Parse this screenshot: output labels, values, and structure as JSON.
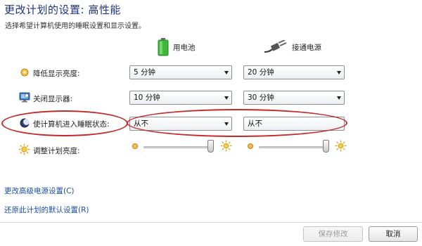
{
  "page": {
    "title": "更改计划的设置: 高性能",
    "subtitle": "选择希望计算机使用的睡眠设置和显示设置。"
  },
  "columns": {
    "battery": {
      "label": "用电池",
      "icon": "battery-icon"
    },
    "plugged": {
      "label": "接通电源",
      "icon": "power-plug-icon"
    }
  },
  "settings": {
    "dim_display": {
      "label": "降低显示亮度:",
      "icon": "sun-dim-icon",
      "battery_value": "5 分钟",
      "plugged_value": "20 分钟"
    },
    "turn_off_display": {
      "label": "关闭显示器:",
      "icon": "monitor-icon",
      "battery_value": "10 分钟",
      "plugged_value": "30 分钟"
    },
    "sleep": {
      "label": "使计算机进入睡眠状态:",
      "icon": "moon-icon",
      "battery_value": "从不",
      "plugged_value": "从不"
    },
    "brightness": {
      "label": "调整计划亮度:",
      "icon": "sun-icon",
      "battery_level": 1.0,
      "plugged_level": 1.0
    }
  },
  "links": {
    "advanced": "更改高级电源设置(C)",
    "restore": "还原此计划的默认设置(R)"
  },
  "buttons": {
    "save": "保存修改",
    "cancel": "取消"
  },
  "colors": {
    "title": "#1e3287",
    "link": "#1a4ea2",
    "annotation": "#c62828"
  }
}
